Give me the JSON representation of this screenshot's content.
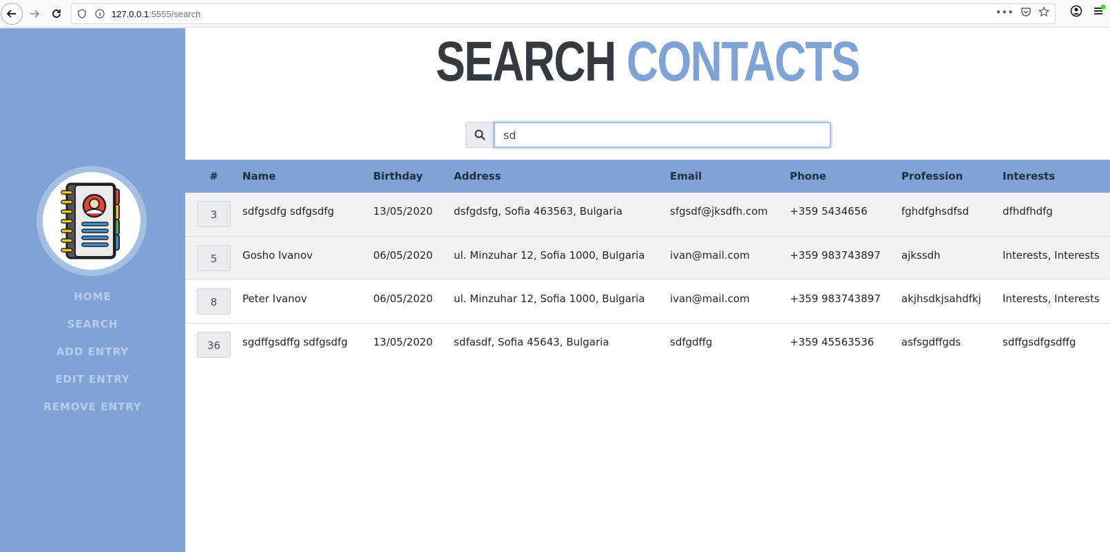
{
  "browser": {
    "url_host": "127.0.0.1",
    "url_rest": ":5555/search"
  },
  "sidebar": {
    "items": [
      {
        "label": "HOME"
      },
      {
        "label": "SEARCH"
      },
      {
        "label": "ADD ENTRY"
      },
      {
        "label": "EDIT ENTRY"
      },
      {
        "label": "REMOVE ENTRY"
      }
    ]
  },
  "page": {
    "title_part1": "SEARCH",
    "title_part2": "CONTACTS"
  },
  "search": {
    "value": "sd"
  },
  "table": {
    "headers": [
      "#",
      "Name",
      "Birthday",
      "Address",
      "Email",
      "Phone",
      "Profession",
      "Interests"
    ],
    "rows": [
      {
        "id": "3",
        "name": "sdfgsdfg sdfgsdfg",
        "birthday": "13/05/2020",
        "address": "dsfgdsfg, Sofia 463563, Bulgaria",
        "email": "sfgsdf@jksdfh.com",
        "phone": "+359 5434656",
        "profession": "fghdfghsdfsd",
        "interests": "dfhdfhdfg"
      },
      {
        "id": "5",
        "name": "Gosho Ivanov",
        "birthday": "06/05/2020",
        "address": "ul. Minzuhar 12, Sofia 1000, Bulgaria",
        "email": "ivan@mail.com",
        "phone": "+359 983743897",
        "profession": "ajkssdh",
        "interests": "Interests, Interests"
      },
      {
        "id": "8",
        "name": "Peter Ivanov",
        "birthday": "06/05/2020",
        "address": "ul. Minzuhar 12, Sofia 1000, Bulgaria",
        "email": "ivan@mail.com",
        "phone": "+359 983743897",
        "profession": "akjhsdkjsahdfkj",
        "interests": "Interests, Interests"
      },
      {
        "id": "36",
        "name": "sgdffgsdffg sdfgsdfg",
        "birthday": "13/05/2020",
        "address": "sdfasdf, Sofia 45643, Bulgaria",
        "email": "sdfgdffg",
        "phone": "+359 45563536",
        "profession": "asfsgdffgds",
        "interests": "sdffgsdfgsdffg"
      }
    ]
  },
  "colors": {
    "accent": "#7fa3d5",
    "title_dark": "#343a40"
  }
}
